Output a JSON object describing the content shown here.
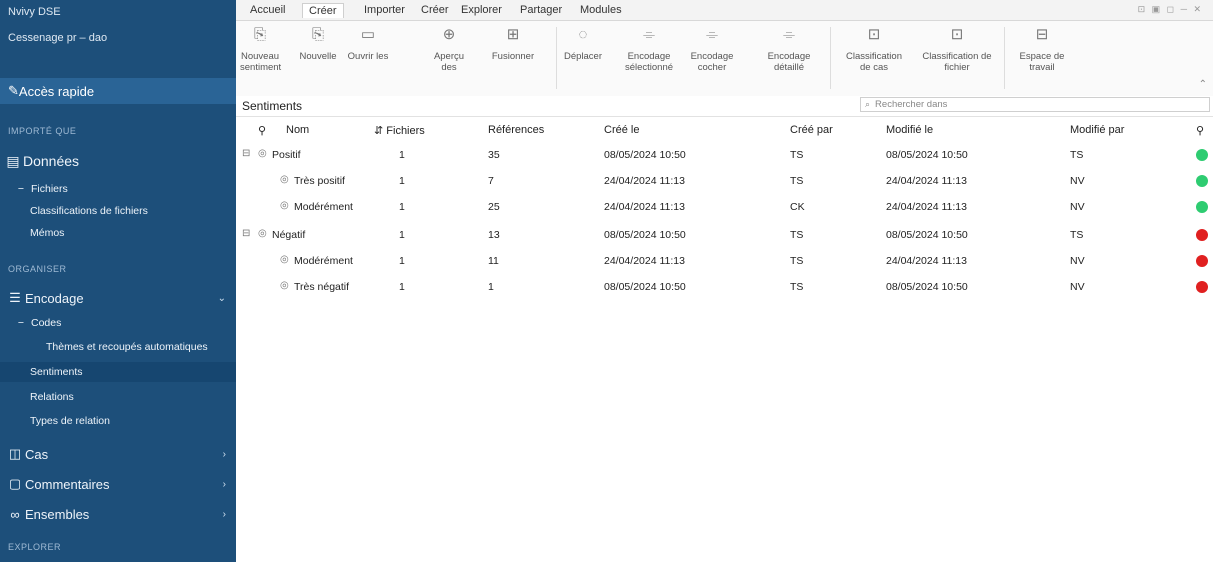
{
  "sidebar": {
    "title": "Nvivy DSE",
    "subtitle": "Cessenage pr – dao",
    "quick_access": "Accès rapide",
    "sections": [
      "IMPORTÉ QUE",
      "ORGANISER",
      "EXPLORER"
    ],
    "items": {
      "donnees": "Données",
      "fichiers": "Fichiers",
      "classifications": "Classifications de fichiers",
      "memos": "Mémos",
      "encodage": "Encodage",
      "codes": "Codes",
      "themes": "Thèmes et recoupés automatiques",
      "sentiments": "Sentiments",
      "relations": "Relations",
      "types_relation": "Types de relation",
      "cas": "Cas",
      "commentaires": "Commentaires",
      "ensembles": "Ensembles"
    }
  },
  "ribbon": {
    "tabs": [
      "Accueil",
      "Créer",
      "Importer",
      "Créer",
      "Explorer",
      "Partager",
      "Modules"
    ],
    "active_tab": 1,
    "buttons": [
      {
        "label": "Nouveau sentiment",
        "icon": "new-icon"
      },
      {
        "label": "Nouvelle",
        "icon": "new-node-icon"
      },
      {
        "label": "Ouvrir les",
        "icon": "open-icon"
      },
      {
        "label": "Aperçu des",
        "icon": "preview-icon"
      },
      {
        "label": "Fusionner",
        "icon": "merge-icon"
      },
      {
        "label": "Déplacer",
        "icon": "move-icon"
      },
      {
        "label": "Encodage sélectionné",
        "icon": "code-icon"
      },
      {
        "label": "Encodage cocher",
        "icon": "code-check-icon"
      },
      {
        "label": "Encodage détaillé",
        "icon": "code-detail-icon"
      },
      {
        "label": "Classification de cas",
        "icon": "case-class-icon"
      },
      {
        "label": "Classification de fichier",
        "icon": "file-class-icon"
      },
      {
        "label": "Espace de travail",
        "icon": "workspace-icon"
      }
    ]
  },
  "breadcrumb": "Sentiments",
  "search": {
    "placeholder": "Rechercher dans"
  },
  "table": {
    "headers": [
      "Nom",
      "Fichiers",
      "Références",
      "Créé le",
      "Créé par",
      "Modifié le",
      "Modifié par"
    ],
    "rows": [
      {
        "name": "Positif",
        "files": "1",
        "refs": "35",
        "created": "08/05/2024 10:50",
        "created_by": "TS",
        "modified": "08/05/2024 10:50",
        "modified_by": "TS",
        "status": "#2ecc71",
        "level": 0,
        "expander": "⊟"
      },
      {
        "name": "Très positif",
        "files": "1",
        "refs": "7",
        "created": "24/04/2024 11:13",
        "created_by": "TS",
        "modified": "24/04/2024 11:13",
        "modified_by": "NV",
        "status": "#2ecc71",
        "level": 1,
        "expander": ""
      },
      {
        "name": "Modérément",
        "files": "1",
        "refs": "25",
        "created": "24/04/2024 11:13",
        "created_by": "CK",
        "modified": "24/04/2024 11:13",
        "modified_by": "NV",
        "status": "#2ecc71",
        "level": 1,
        "expander": ""
      },
      {
        "name": "Négatif",
        "files": "1",
        "refs": "13",
        "created": "08/05/2024 10:50",
        "created_by": "TS",
        "modified": "08/05/2024 10:50",
        "modified_by": "TS",
        "status": "#e02020",
        "level": 0,
        "expander": "⊟"
      },
      {
        "name": "Modérément",
        "files": "1",
        "refs": "11",
        "created": "24/04/2024 11:13",
        "created_by": "TS",
        "modified": "24/04/2024 11:13",
        "modified_by": "NV",
        "status": "#e02020",
        "level": 1,
        "expander": ""
      },
      {
        "name": "Très négatif",
        "files": "1",
        "refs": "1",
        "created": "08/05/2024 10:50",
        "created_by": "TS",
        "modified": "08/05/2024 10:50",
        "modified_by": "NV",
        "status": "#e02020",
        "level": 1,
        "expander": ""
      }
    ]
  }
}
